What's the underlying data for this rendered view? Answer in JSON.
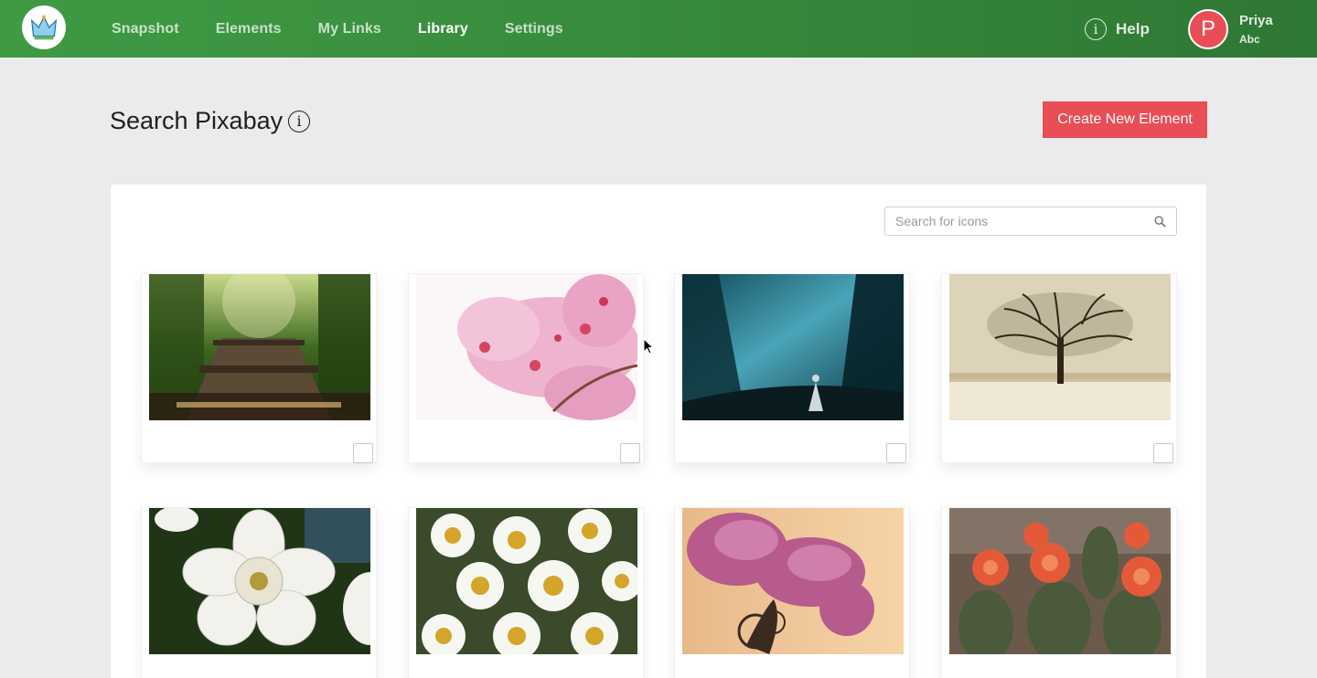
{
  "nav": {
    "items": [
      {
        "label": "Snapshot"
      },
      {
        "label": "Elements"
      },
      {
        "label": "My Links"
      },
      {
        "label": "Library"
      },
      {
        "label": "Settings"
      }
    ],
    "active": "Library"
  },
  "help": {
    "label": "Help",
    "icon": "info-circle-icon"
  },
  "user": {
    "initial": "P",
    "name": "Priya",
    "org": "Abc",
    "avatar_color": "#e94d55"
  },
  "page": {
    "title": "Search Pixabay",
    "title_icon": "info-circle-icon",
    "create_button": "Create New Element"
  },
  "search": {
    "placeholder": "Search for icons",
    "value": "",
    "icon": "magnifier-icon"
  },
  "images": [
    {
      "name": "forest-bridge-image",
      "checked": false
    },
    {
      "name": "cherry-blossom-image",
      "checked": false
    },
    {
      "name": "misty-forest-figure-image",
      "checked": false
    },
    {
      "name": "bare-tree-field-image",
      "checked": false
    },
    {
      "name": "white-daffodil-image",
      "checked": false
    },
    {
      "name": "daisies-image",
      "checked": false
    },
    {
      "name": "lilac-image",
      "checked": false
    },
    {
      "name": "cactus-flowers-image",
      "checked": false
    }
  ],
  "colors": {
    "header_green": "#3f9a44",
    "accent_red": "#e94d55",
    "page_bg": "#ebebed"
  }
}
